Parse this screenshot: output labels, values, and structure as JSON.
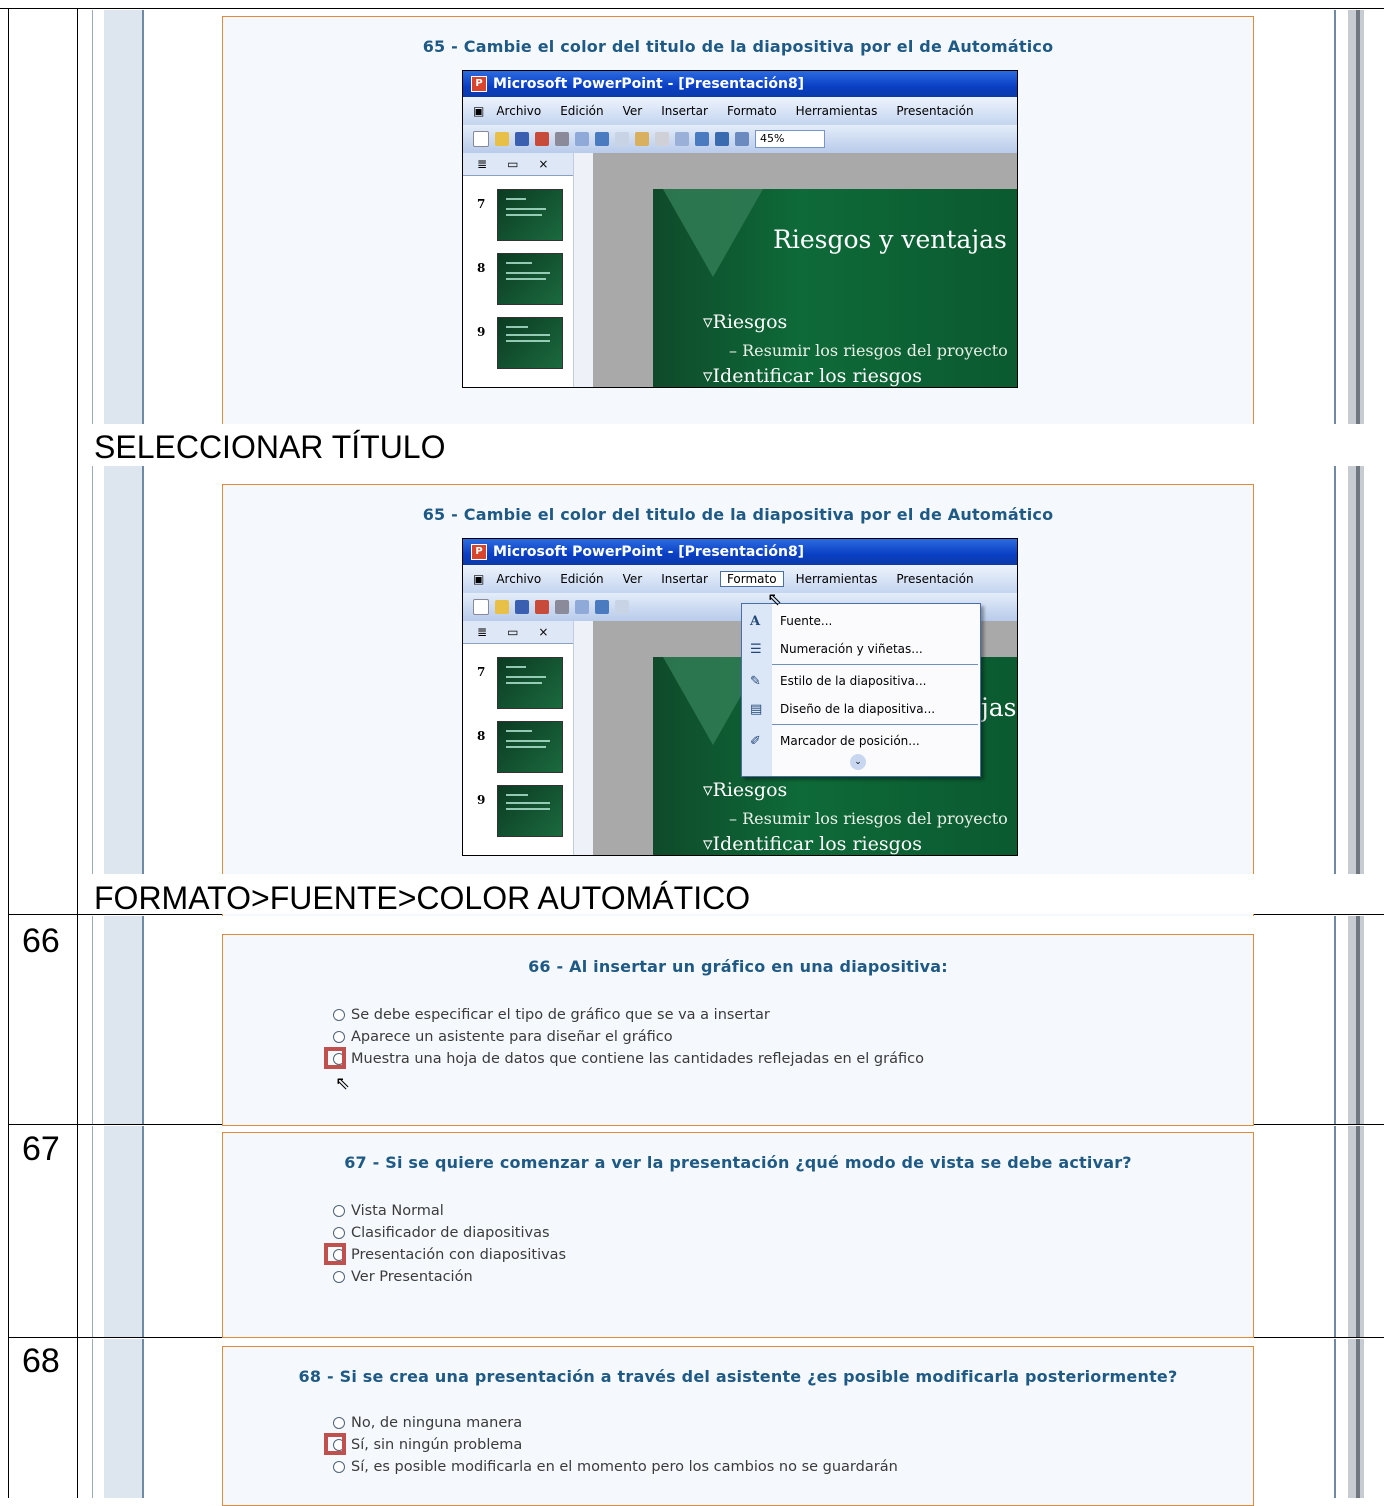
{
  "rows": {
    "row66_number": "66",
    "row67_number": "67",
    "row68_number": "68"
  },
  "q65": {
    "title": "65 - Cambie el color del titulo de la diapositiva por el de Automático",
    "caption1": "SELECCIONAR TÍTULO",
    "caption2": "FORMATO>FUENTE>COLOR AUTOMÁTICO"
  },
  "powerpoint": {
    "window_title": "Microsoft PowerPoint - [Presentación8]",
    "menus": [
      "Archivo",
      "Edición",
      "Ver",
      "Insertar",
      "Formato",
      "Herramientas",
      "Presentación"
    ],
    "zoom": "45%",
    "tab_close": "×",
    "slide_numbers": [
      "7",
      "8",
      "9"
    ],
    "slide_title": "Riesgos y ventajas",
    "slide_title_partial": "jas",
    "bullet1": "Riesgos",
    "bullet1_sub": "– Resumir los riesgos del proyecto",
    "bullet2": "Identificar los riesgos",
    "format_menu": {
      "items": [
        "Fuente...",
        "Numeración y viñetas...",
        "Estilo de la diapositiva...",
        "Diseño de la diapositiva...",
        "Marcador de posición..."
      ]
    }
  },
  "q66": {
    "title": "66 - Al insertar un gráfico en una diapositiva:",
    "options": [
      "Se debe especificar el tipo de gráfico que se va a insertar",
      "Aparece un asistente para diseñar el gráfico",
      "Muestra una hoja de datos que contiene las cantidades reflejadas en el gráfico"
    ],
    "selected_index": 2
  },
  "q67": {
    "title": "67 - Si se quiere comenzar a ver la presentación ¿qué modo de vista se debe activar?",
    "options": [
      "Vista Normal",
      "Clasificador de diapositivas",
      "Presentación con diapositivas",
      "Ver Presentación"
    ],
    "selected_index": 2
  },
  "q68": {
    "title": "68 - Si se crea una presentación a través del asistente ¿es posible modificarla posteriormente?",
    "options": [
      "No, de ninguna manera",
      "Sí, sin ningún problema",
      "Sí, es posible modificarla en el momento pero los cambios no se guardarán"
    ],
    "selected_index": 1
  },
  "colors": {
    "panel_border": "#e08a3c",
    "title_blue": "#1f5a85",
    "highlight_red": "#c0504d"
  }
}
